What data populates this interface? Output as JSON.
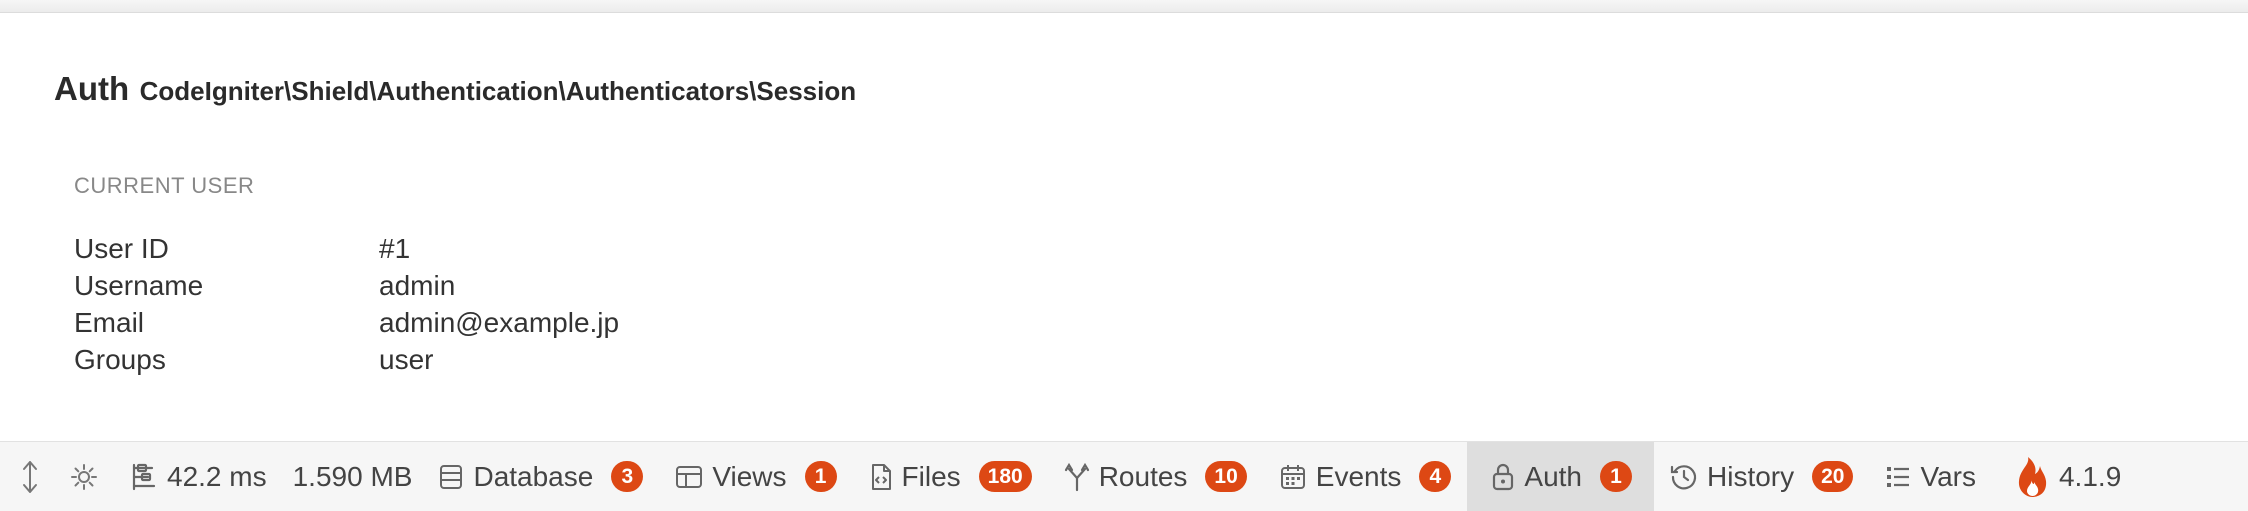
{
  "panel": {
    "title": "Auth",
    "subtitle": "CodeIgniter\\Shield\\Authentication\\Authenticators\\Session",
    "section_heading": "CURRENT USER",
    "rows": [
      {
        "label": "User ID",
        "value": "#1"
      },
      {
        "label": "Username",
        "value": "admin"
      },
      {
        "label": "Email",
        "value": "admin@example.jp"
      },
      {
        "label": "Groups",
        "value": "user"
      }
    ]
  },
  "toolbar": {
    "accent_color": "#dd4814",
    "time": "42.2 ms",
    "memory": "1.590 MB",
    "version": "4.1.9",
    "items": [
      {
        "label": "Database",
        "badge": "3",
        "icon": "database-icon"
      },
      {
        "label": "Views",
        "badge": "1",
        "icon": "views-icon"
      },
      {
        "label": "Files",
        "badge": "180",
        "icon": "files-icon"
      },
      {
        "label": "Routes",
        "badge": "10",
        "icon": "routes-icon"
      },
      {
        "label": "Events",
        "badge": "4",
        "icon": "calendar-icon"
      },
      {
        "label": "Auth",
        "badge": "1",
        "icon": "lock-icon",
        "active": true
      },
      {
        "label": "History",
        "badge": "20",
        "icon": "history-icon"
      },
      {
        "label": "Vars",
        "icon": "list-icon"
      }
    ]
  }
}
